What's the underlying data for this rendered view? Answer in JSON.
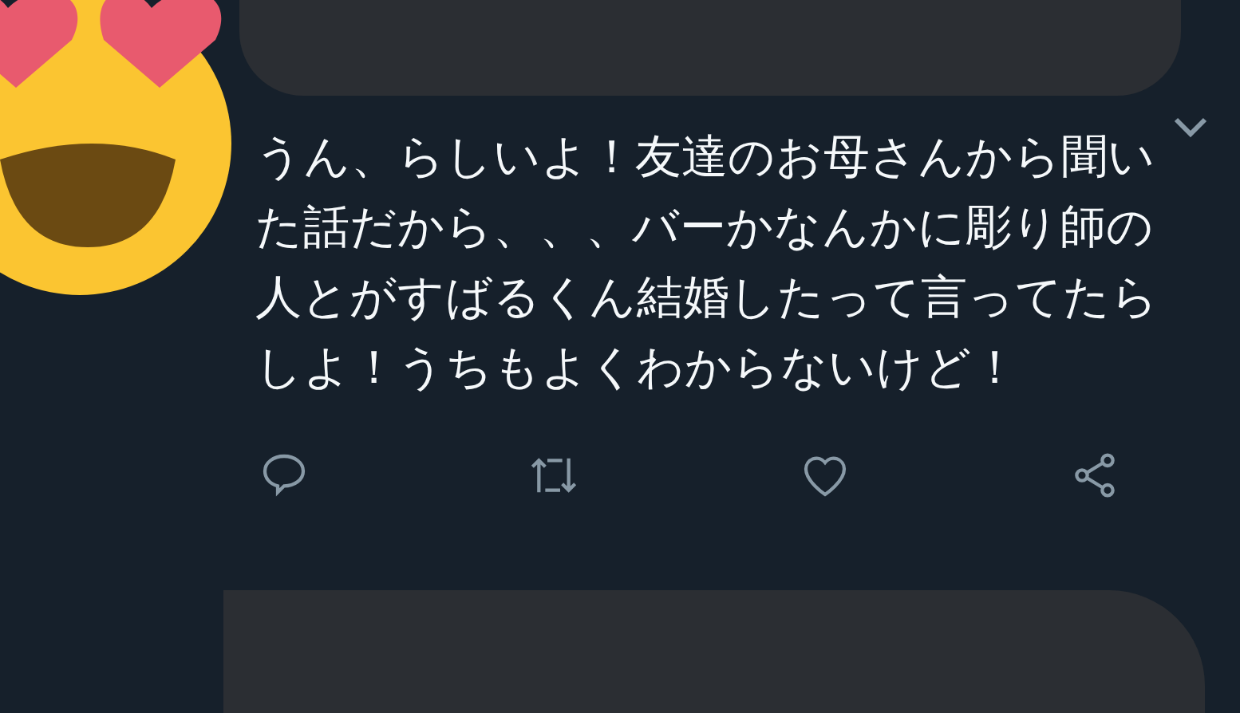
{
  "tweet": {
    "text": "うん、らしいよ！友達のお母さんから聞いた話だから、、、バーかなんかに彫り師の人とがすばるくん結婚したって言ってたらしよ！うちもよくわからないけど！"
  }
}
